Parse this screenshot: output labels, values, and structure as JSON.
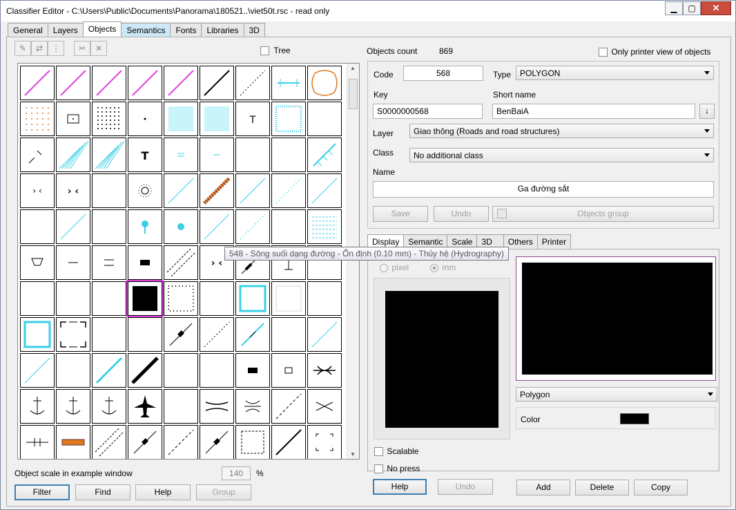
{
  "window": {
    "title": "Classifier Editor - C:\\Users\\Public\\Documents\\Panorama\\180521..\\viet50t.rsc - read only",
    "close_label": "✕"
  },
  "main_tabs": [
    "General",
    "Layers",
    "Objects",
    "Semantics",
    "Fonts",
    "Libraries",
    "3D"
  ],
  "left": {
    "tree_label": "Tree",
    "scale_label": "Object scale in example window",
    "scale_value": "140",
    "scale_unit": "%",
    "buttons": {
      "filter": "Filter",
      "find": "Find",
      "help": "Help",
      "group": "Group"
    }
  },
  "tooltip": "548 - Sông suối dạng đường - Ổn định (0.10 mm) - Thủy hệ (Hydrography)",
  "right": {
    "objects_count_label": "Objects count",
    "objects_count_value": "869",
    "only_printer_label": "Only printer view of objects",
    "code_label": "Code",
    "code_value": "568",
    "type_label": "Type",
    "type_value": "POLYGON",
    "key_label": "Key",
    "key_value": "S0000000568",
    "short_name_label": "Short name",
    "short_name_value": "BenBaiA",
    "layer_label": "Layer",
    "layer_value": "Giao thông (Roads and road structures)",
    "class_label": "Class",
    "class_value": "No additional class",
    "name_label": "Name",
    "name_value": "Ga đường sắt",
    "save_label": "Save",
    "undo_label": "Undo",
    "objects_group_label": "Objects group"
  },
  "sub_tabs": [
    "Display",
    "Semantic",
    "Scale",
    "3D",
    "Others",
    "Printer"
  ],
  "display": {
    "pixel_label": "pixel",
    "mm_label": "mm",
    "style_value": "Polygon",
    "color_label": "Color",
    "scalable_label": "Scalable",
    "no_press_label": "No press",
    "help_label": "Help",
    "undo_label": "Undo",
    "add_label": "Add",
    "delete_label": "Delete",
    "copy_label": "Copy"
  },
  "colors": {
    "accent_blue": "#3c7fb1",
    "magenta": "#e040e0",
    "cyan": "#38d0e8",
    "orange": "#e07820"
  }
}
